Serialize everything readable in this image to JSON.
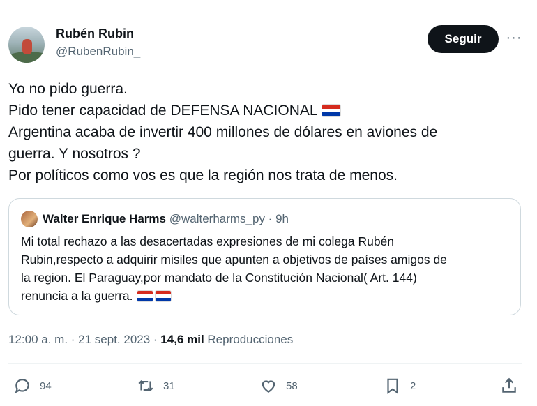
{
  "author": {
    "name": "Rubén Rubin",
    "handle": "@RubenRubin_"
  },
  "follow_label": "Seguir",
  "more_label": "···",
  "tweet_lines": [
    "Yo no pido guerra.",
    "Pido tener capacidad de DEFENSA NACIONAL",
    "Argentina acaba de invertir 400 millones de dólares en aviones de",
    "guerra. Y nosotros ?",
    "Por políticos como vos es que la región nos trata de menos."
  ],
  "quote": {
    "name": "Walter Enrique Harms",
    "handle_time": "@walterharms_py · 9h",
    "lines": [
      "Mi total rechazo a las desacertadas expresiones de mi colega Rubén",
      "Rubin,respecto a adquirir misiles que apunten a objetivos de países amigos de",
      "la region. El Paraguay,por mandato de la Constitución Nacional( Art. 144)",
      "renuncia a la guerra."
    ]
  },
  "meta": {
    "time": "12:00 a. m. · 21 sept. 2023 · ",
    "views": "14,6 mil",
    "views_label": "Reproducciones"
  },
  "actions": {
    "replies": "94",
    "reposts": "31",
    "likes": "58",
    "bookmarks": "2"
  },
  "colors": {
    "flag_red": "#d52b1e",
    "flag_white": "#ffffff",
    "flag_blue": "#0038a8"
  }
}
